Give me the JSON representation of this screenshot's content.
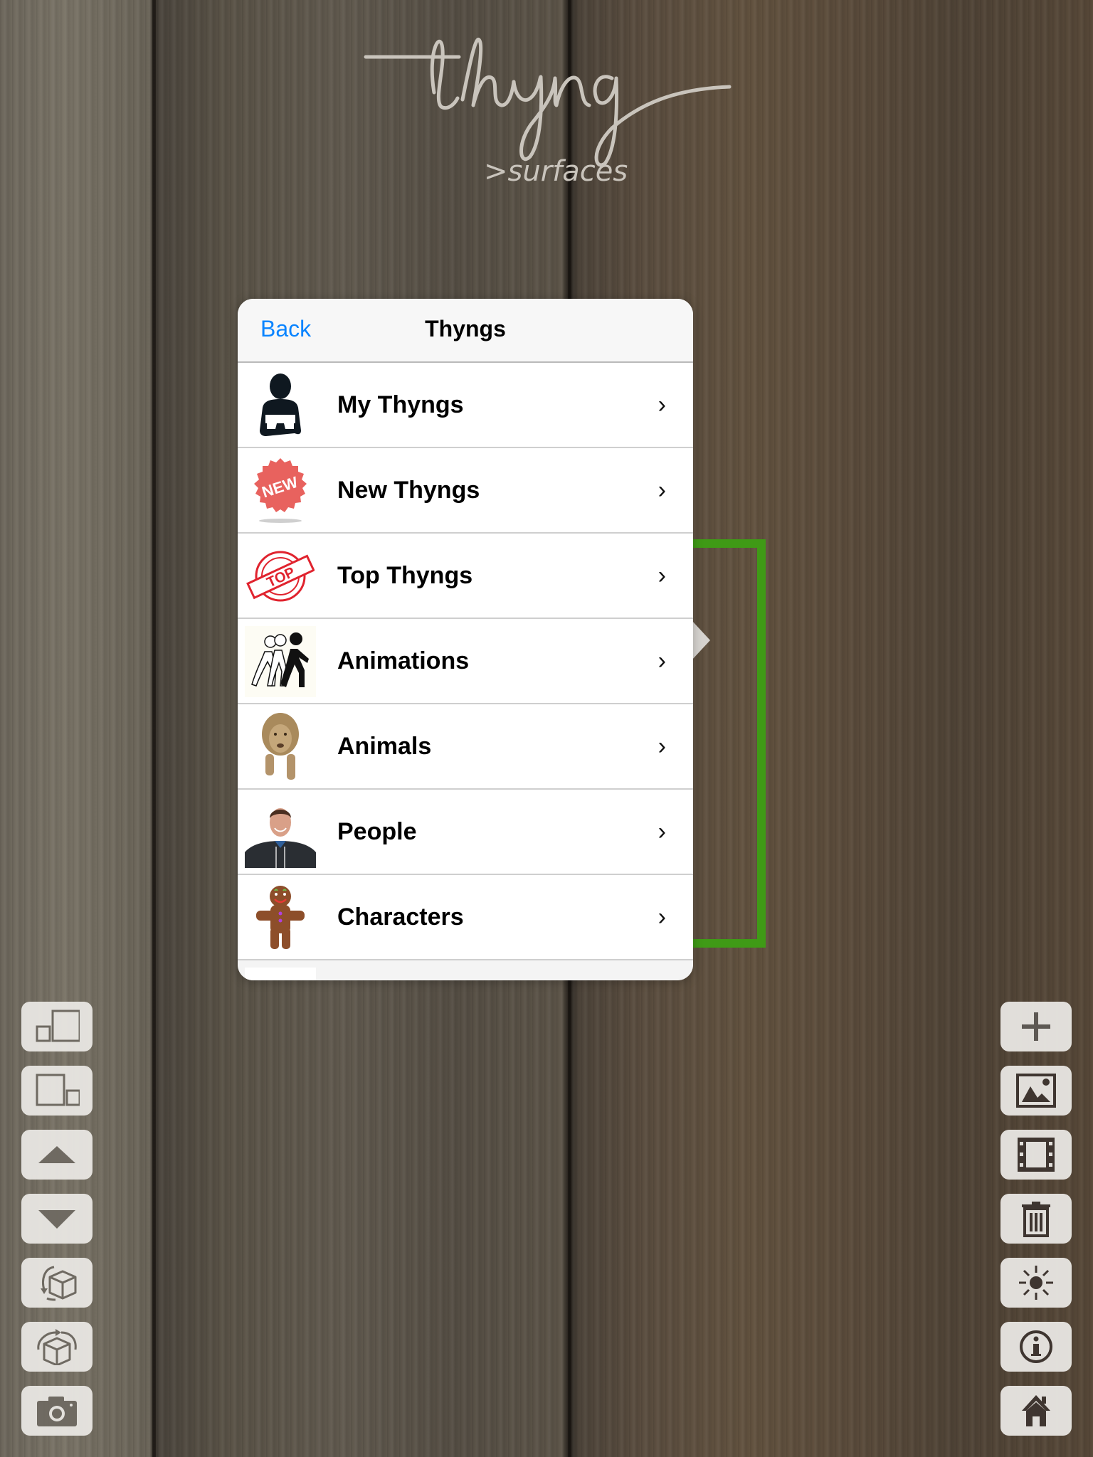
{
  "logo": {
    "wordmark": "thyng",
    "subtitle": ">surfaces"
  },
  "popover": {
    "back_label": "Back",
    "title": "Thyngs",
    "items": [
      {
        "label": "My Thyngs",
        "icon": "person-holding-tablet-icon",
        "chevron": "›"
      },
      {
        "label": "New Thyngs",
        "icon": "new-badge-icon",
        "chevron": "›"
      },
      {
        "label": "Top Thyngs",
        "icon": "top-stamp-icon",
        "chevron": "›"
      },
      {
        "label": "Animations",
        "icon": "walking-figures-icon",
        "chevron": "›"
      },
      {
        "label": "Animals",
        "icon": "lion-thumbnail",
        "chevron": "›"
      },
      {
        "label": "People",
        "icon": "person-photo-thumbnail",
        "chevron": "›"
      },
      {
        "label": "Characters",
        "icon": "gingerbread-man-thumbnail",
        "chevron": "›"
      }
    ],
    "new_badge_text": "NEW",
    "top_stamp_text": "TOP"
  },
  "left_toolbar": [
    {
      "name": "scale-down-button",
      "icon": "scale-down-icon"
    },
    {
      "name": "scale-up-button",
      "icon": "scale-up-icon"
    },
    {
      "name": "move-up-button",
      "icon": "triangle-up-icon"
    },
    {
      "name": "move-down-button",
      "icon": "triangle-down-icon"
    },
    {
      "name": "rotate-vertical-button",
      "icon": "rotate-cube-vertical-icon"
    },
    {
      "name": "rotate-horizontal-button",
      "icon": "rotate-cube-horizontal-icon"
    },
    {
      "name": "camera-button",
      "icon": "camera-icon"
    }
  ],
  "right_toolbar": [
    {
      "name": "add-button",
      "icon": "plus-icon"
    },
    {
      "name": "image-button",
      "icon": "image-icon"
    },
    {
      "name": "video-button",
      "icon": "film-icon"
    },
    {
      "name": "delete-button",
      "icon": "trash-icon"
    },
    {
      "name": "brightness-button",
      "icon": "sun-icon"
    },
    {
      "name": "info-button",
      "icon": "info-icon"
    },
    {
      "name": "home-button",
      "icon": "home-icon"
    }
  ],
  "colors": {
    "accent_blue": "#0a84ff",
    "selection_green": "#3f9a16",
    "badge_red": "#e8625e",
    "stamp_red": "#e0232e"
  }
}
